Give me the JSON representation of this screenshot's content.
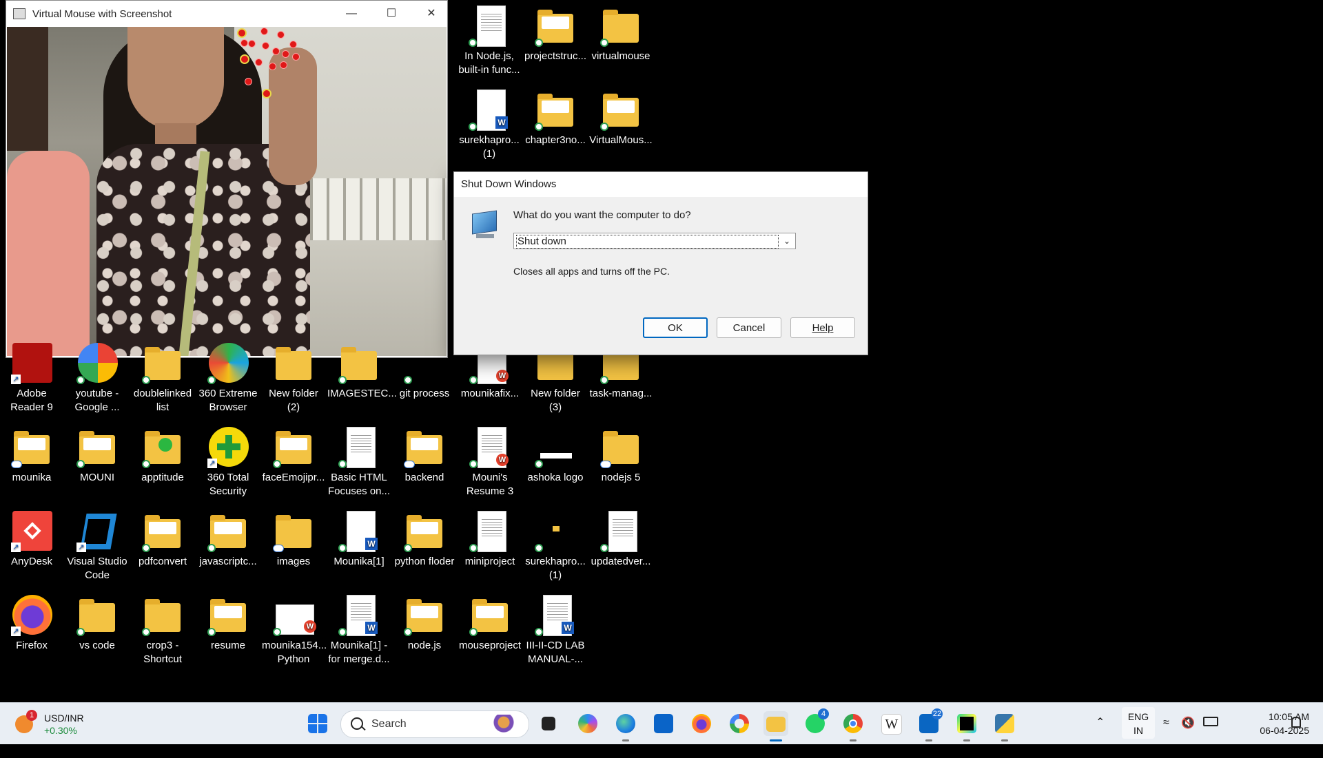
{
  "camera_window": {
    "title": "Virtual Mouse with Screenshot",
    "minimize": "—",
    "maximize": "☐",
    "close": "✕"
  },
  "dialog": {
    "title": "Shut Down Windows",
    "question": "What do you want the computer to do?",
    "selected_option": "Shut down",
    "description": "Closes all apps and turns off the PC.",
    "ok_label": "OK",
    "cancel_label": "Cancel",
    "help_label": "Help"
  },
  "desktop": {
    "top_icons": [
      {
        "label": "In Node.js, built-in func...",
        "kind": "doc"
      },
      {
        "label": "projectstruc...",
        "kind": "folder"
      },
      {
        "label": "virtualmouse",
        "kind": "folder"
      },
      {
        "label": "surekhapro... (1)",
        "kind": "word"
      },
      {
        "label": "chapter3no...",
        "kind": "folder"
      },
      {
        "label": "VirtualMous...",
        "kind": "folder"
      }
    ],
    "row1": [
      {
        "label": "Adobe Reader 9"
      },
      {
        "label": "youtube - Google ..."
      },
      {
        "label": "doublelinked list"
      },
      {
        "label": "360 Extreme Browser"
      },
      {
        "label": "New folder (2)"
      },
      {
        "label": "IMAGESTEC..."
      },
      {
        "label": "git process"
      },
      {
        "label": "mounikafix..."
      },
      {
        "label": "New folder (3)"
      },
      {
        "label": "task-manag..."
      }
    ],
    "row2": [
      {
        "label": "mounika"
      },
      {
        "label": "MOUNI"
      },
      {
        "label": "apptitude"
      },
      {
        "label": "360 Total Security"
      },
      {
        "label": "faceEmojipr..."
      },
      {
        "label": "Basic HTML Focuses on..."
      },
      {
        "label": "backend"
      },
      {
        "label": "Mouni's Resume 3"
      },
      {
        "label": "ashoka logo"
      },
      {
        "label": "nodejs 5"
      }
    ],
    "row3": [
      {
        "label": "AnyDesk"
      },
      {
        "label": "Visual Studio Code"
      },
      {
        "label": "pdfconvert"
      },
      {
        "label": "javascriptc..."
      },
      {
        "label": "images"
      },
      {
        "label": "Mounika[1]"
      },
      {
        "label": "python floder"
      },
      {
        "label": "miniproject"
      },
      {
        "label": "surekhapro... (1)"
      },
      {
        "label": "updatedver..."
      }
    ],
    "row4": [
      {
        "label": "Firefox"
      },
      {
        "label": "vs code"
      },
      {
        "label": "crop3 - Shortcut"
      },
      {
        "label": "resume"
      },
      {
        "label": "mounika154... Python"
      },
      {
        "label": "Mounika[1] - for merge.d..."
      },
      {
        "label": "node.js"
      },
      {
        "label": "mouseproject"
      },
      {
        "label": "III-II-CD LAB MANUAL-..."
      }
    ]
  },
  "taskbar": {
    "widget_badge": "1",
    "widget_title": "USD/INR",
    "widget_value": "+0.30%",
    "search_placeholder": "Search",
    "whatsapp_badge": "4",
    "linkedin_badge": "22",
    "language_line1": "ENG",
    "language_line2": "IN",
    "time": "10:05 AM",
    "date": "06-04-2025",
    "apps": [
      "start-icon",
      "task-view-icon",
      "copilot-icon",
      "edge-icon",
      "outlook-icon",
      "firefox-icon",
      "google-icon",
      "file-explorer-icon",
      "whatsapp-icon",
      "chrome-icon",
      "wikipedia-icon",
      "linkedin-icon",
      "pycharm-icon",
      "python-idle-icon"
    ]
  },
  "colors": {
    "taskbar_bg": "#e9eef4",
    "dialog_bg": "#f0f0f0",
    "accent": "#0067c0",
    "folder": "#f3c343"
  }
}
